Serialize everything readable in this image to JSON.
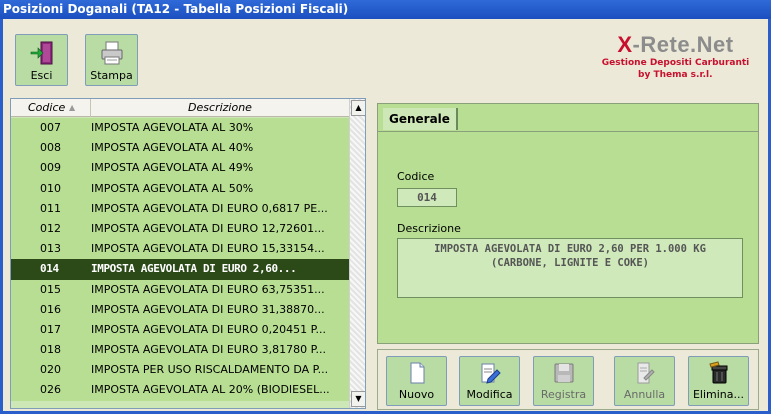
{
  "window": {
    "title": "Posizioni Doganali (TA12 - Tabella Posizioni Fiscali)"
  },
  "toolbar": {
    "exit_label": "Esci",
    "print_label": "Stampa"
  },
  "brand": {
    "name_prefix": "X",
    "name_rest": "-Rete.Net",
    "tagline": "Gestione Depositi Carburanti",
    "company": "by Thema s.r.l."
  },
  "grid": {
    "headers": {
      "code": "Codice",
      "description": "Descrizione"
    },
    "rows": [
      {
        "code": "007",
        "desc": "IMPOSTA AGEVOLATA AL 30%"
      },
      {
        "code": "008",
        "desc": "IMPOSTA AGEVOLATA AL 40%"
      },
      {
        "code": "009",
        "desc": "IMPOSTA AGEVOLATA AL 49%"
      },
      {
        "code": "010",
        "desc": "IMPOSTA AGEVOLATA AL 50%"
      },
      {
        "code": "011",
        "desc": "IMPOSTA AGEVOLATA DI EURO 0,6817 PE..."
      },
      {
        "code": "012",
        "desc": "IMPOSTA AGEVOLATA DI EURO 12,72601..."
      },
      {
        "code": "013",
        "desc": "IMPOSTA AGEVOLATA DI EURO 15,33154..."
      },
      {
        "code": "014",
        "desc": "IMPOSTA AGEVOLATA DI EURO 2,60...",
        "selected": true
      },
      {
        "code": "015",
        "desc": "IMPOSTA AGEVOLATA DI EURO 63,75351..."
      },
      {
        "code": "016",
        "desc": "IMPOSTA AGEVOLATA DI EURO 31,38870..."
      },
      {
        "code": "017",
        "desc": "IMPOSTA AGEVOLATA DI EURO 0,20451 P..."
      },
      {
        "code": "018",
        "desc": "IMPOSTA AGEVOLATA DI EURO 3,81780 P..."
      },
      {
        "code": "020",
        "desc": "IMPOSTA PER USO RISCALDAMENTO DA P..."
      },
      {
        "code": "026",
        "desc": "IMPOSTA AGEVOLATA AL 20% (BIODIESEL..."
      }
    ]
  },
  "detail": {
    "tab_label": "Generale",
    "code_label": "Codice",
    "code_value": "014",
    "desc_label": "Descrizione",
    "desc_line1": "IMPOSTA AGEVOLATA DI EURO 2,60 PER 1.000 KG",
    "desc_line2": "(CARBONE, LIGNITE E COKE)"
  },
  "actions": {
    "new_label": "Nuovo",
    "edit_label": "Modifica",
    "save_label": "Registra",
    "cancel_label": "Annulla",
    "delete_label": "Elimina..."
  },
  "colors": {
    "row_bg": "#b7de92",
    "row_selected_bg": "#2b4a18",
    "title_bar": "#1c4fbf",
    "brand_red": "#c8102e"
  }
}
